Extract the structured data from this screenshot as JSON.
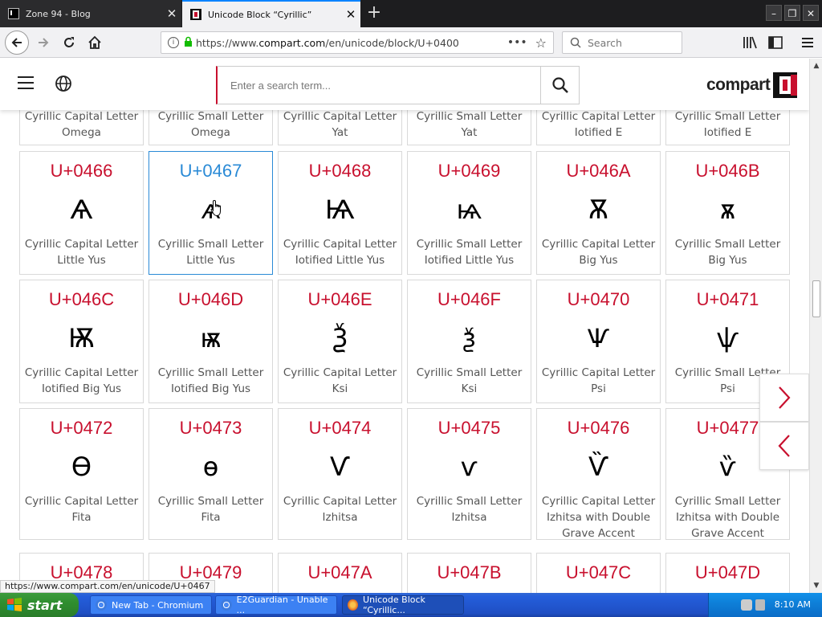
{
  "browser": {
    "tabs": [
      {
        "title": "Zone 94 - Blog",
        "active": false
      },
      {
        "title": "Unicode Block “Cyrillic”",
        "active": true
      }
    ],
    "url_prefix": "https://www.",
    "url_domain": "compart.com",
    "url_path": "/en/unicode/block/U+0400",
    "search_placeholder": "Search",
    "status_url": "https://www.compart.com/en/unicode/U+0467"
  },
  "site": {
    "search_placeholder": "Enter a search term...",
    "logo_text": "compart",
    "accent_color": "#c8102e",
    "active_color": "#2a8ad6"
  },
  "rows": [
    {
      "cards": [
        {
          "code": "",
          "glyph": "",
          "name": "Cyrillic Capital Letter Omega"
        },
        {
          "code": "",
          "glyph": "",
          "name": "Cyrillic Small Letter Omega"
        },
        {
          "code": "",
          "glyph": "",
          "name": "Cyrillic Capital Letter Yat"
        },
        {
          "code": "",
          "glyph": "",
          "name": "Cyrillic Small Letter Yat"
        },
        {
          "code": "",
          "glyph": "",
          "name": "Cyrillic Capital Letter Iotified E"
        },
        {
          "code": "",
          "glyph": "",
          "name": "Cyrillic Small Letter Iotified E"
        }
      ]
    },
    {
      "cards": [
        {
          "code": "U+0466",
          "glyph": "Ѧ",
          "name": "Cyrillic Capital Letter Little Yus"
        },
        {
          "code": "U+0467",
          "glyph": "ѧ",
          "name": "Cyrillic Small Letter Little Yus",
          "active": true
        },
        {
          "code": "U+0468",
          "glyph": "Ѩ",
          "name": "Cyrillic Capital Letter Iotified Little Yus"
        },
        {
          "code": "U+0469",
          "glyph": "ѩ",
          "name": "Cyrillic Small Letter Iotified Little Yus"
        },
        {
          "code": "U+046A",
          "glyph": "Ѫ",
          "name": "Cyrillic Capital Letter Big Yus"
        },
        {
          "code": "U+046B",
          "glyph": "ѫ",
          "name": "Cyrillic Small Letter Big Yus"
        }
      ]
    },
    {
      "cards": [
        {
          "code": "U+046C",
          "glyph": "Ѭ",
          "name": "Cyrillic Capital Letter Iotified Big Yus"
        },
        {
          "code": "U+046D",
          "glyph": "ѭ",
          "name": "Cyrillic Small Letter Iotified Big Yus"
        },
        {
          "code": "U+046E",
          "glyph": "Ѯ",
          "name": "Cyrillic Capital Letter Ksi"
        },
        {
          "code": "U+046F",
          "glyph": "ѯ",
          "name": "Cyrillic Small Letter Ksi"
        },
        {
          "code": "U+0470",
          "glyph": "Ѱ",
          "name": "Cyrillic Capital Letter Psi"
        },
        {
          "code": "U+0471",
          "glyph": "ѱ",
          "name": "Cyrillic Small Letter Psi"
        }
      ]
    },
    {
      "cards": [
        {
          "code": "U+0472",
          "glyph": "Ѳ",
          "name": "Cyrillic Capital Letter Fita"
        },
        {
          "code": "U+0473",
          "glyph": "ѳ",
          "name": "Cyrillic Small Letter Fita"
        },
        {
          "code": "U+0474",
          "glyph": "Ѵ",
          "name": "Cyrillic Capital Letter Izhitsa"
        },
        {
          "code": "U+0475",
          "glyph": "ѵ",
          "name": "Cyrillic Small Letter Izhitsa"
        },
        {
          "code": "U+0476",
          "glyph": "Ѷ",
          "name": "Cyrillic Capital Letter Izhitsa with Double Grave Accent"
        },
        {
          "code": "U+0477",
          "glyph": "ѷ",
          "name": "Cyrillic Small Letter Izhitsa with Double Grave Accent"
        }
      ]
    },
    {
      "cards": [
        {
          "code": "U+0478",
          "glyph": "",
          "name": ""
        },
        {
          "code": "U+0479",
          "glyph": "",
          "name": ""
        },
        {
          "code": "U+047A",
          "glyph": "",
          "name": ""
        },
        {
          "code": "U+047B",
          "glyph": "",
          "name": ""
        },
        {
          "code": "U+047C",
          "glyph": "",
          "name": ""
        },
        {
          "code": "U+047D",
          "glyph": "",
          "name": ""
        }
      ]
    }
  ],
  "taskbar": {
    "start_label": "start",
    "tasks": [
      {
        "label": "New Tab - Chromium",
        "active": false
      },
      {
        "label": "E2Guardian - Unable ...",
        "active": false
      },
      {
        "label": "Unicode Block “Cyrillic...",
        "active": true
      }
    ],
    "clock": "8:10 AM"
  }
}
